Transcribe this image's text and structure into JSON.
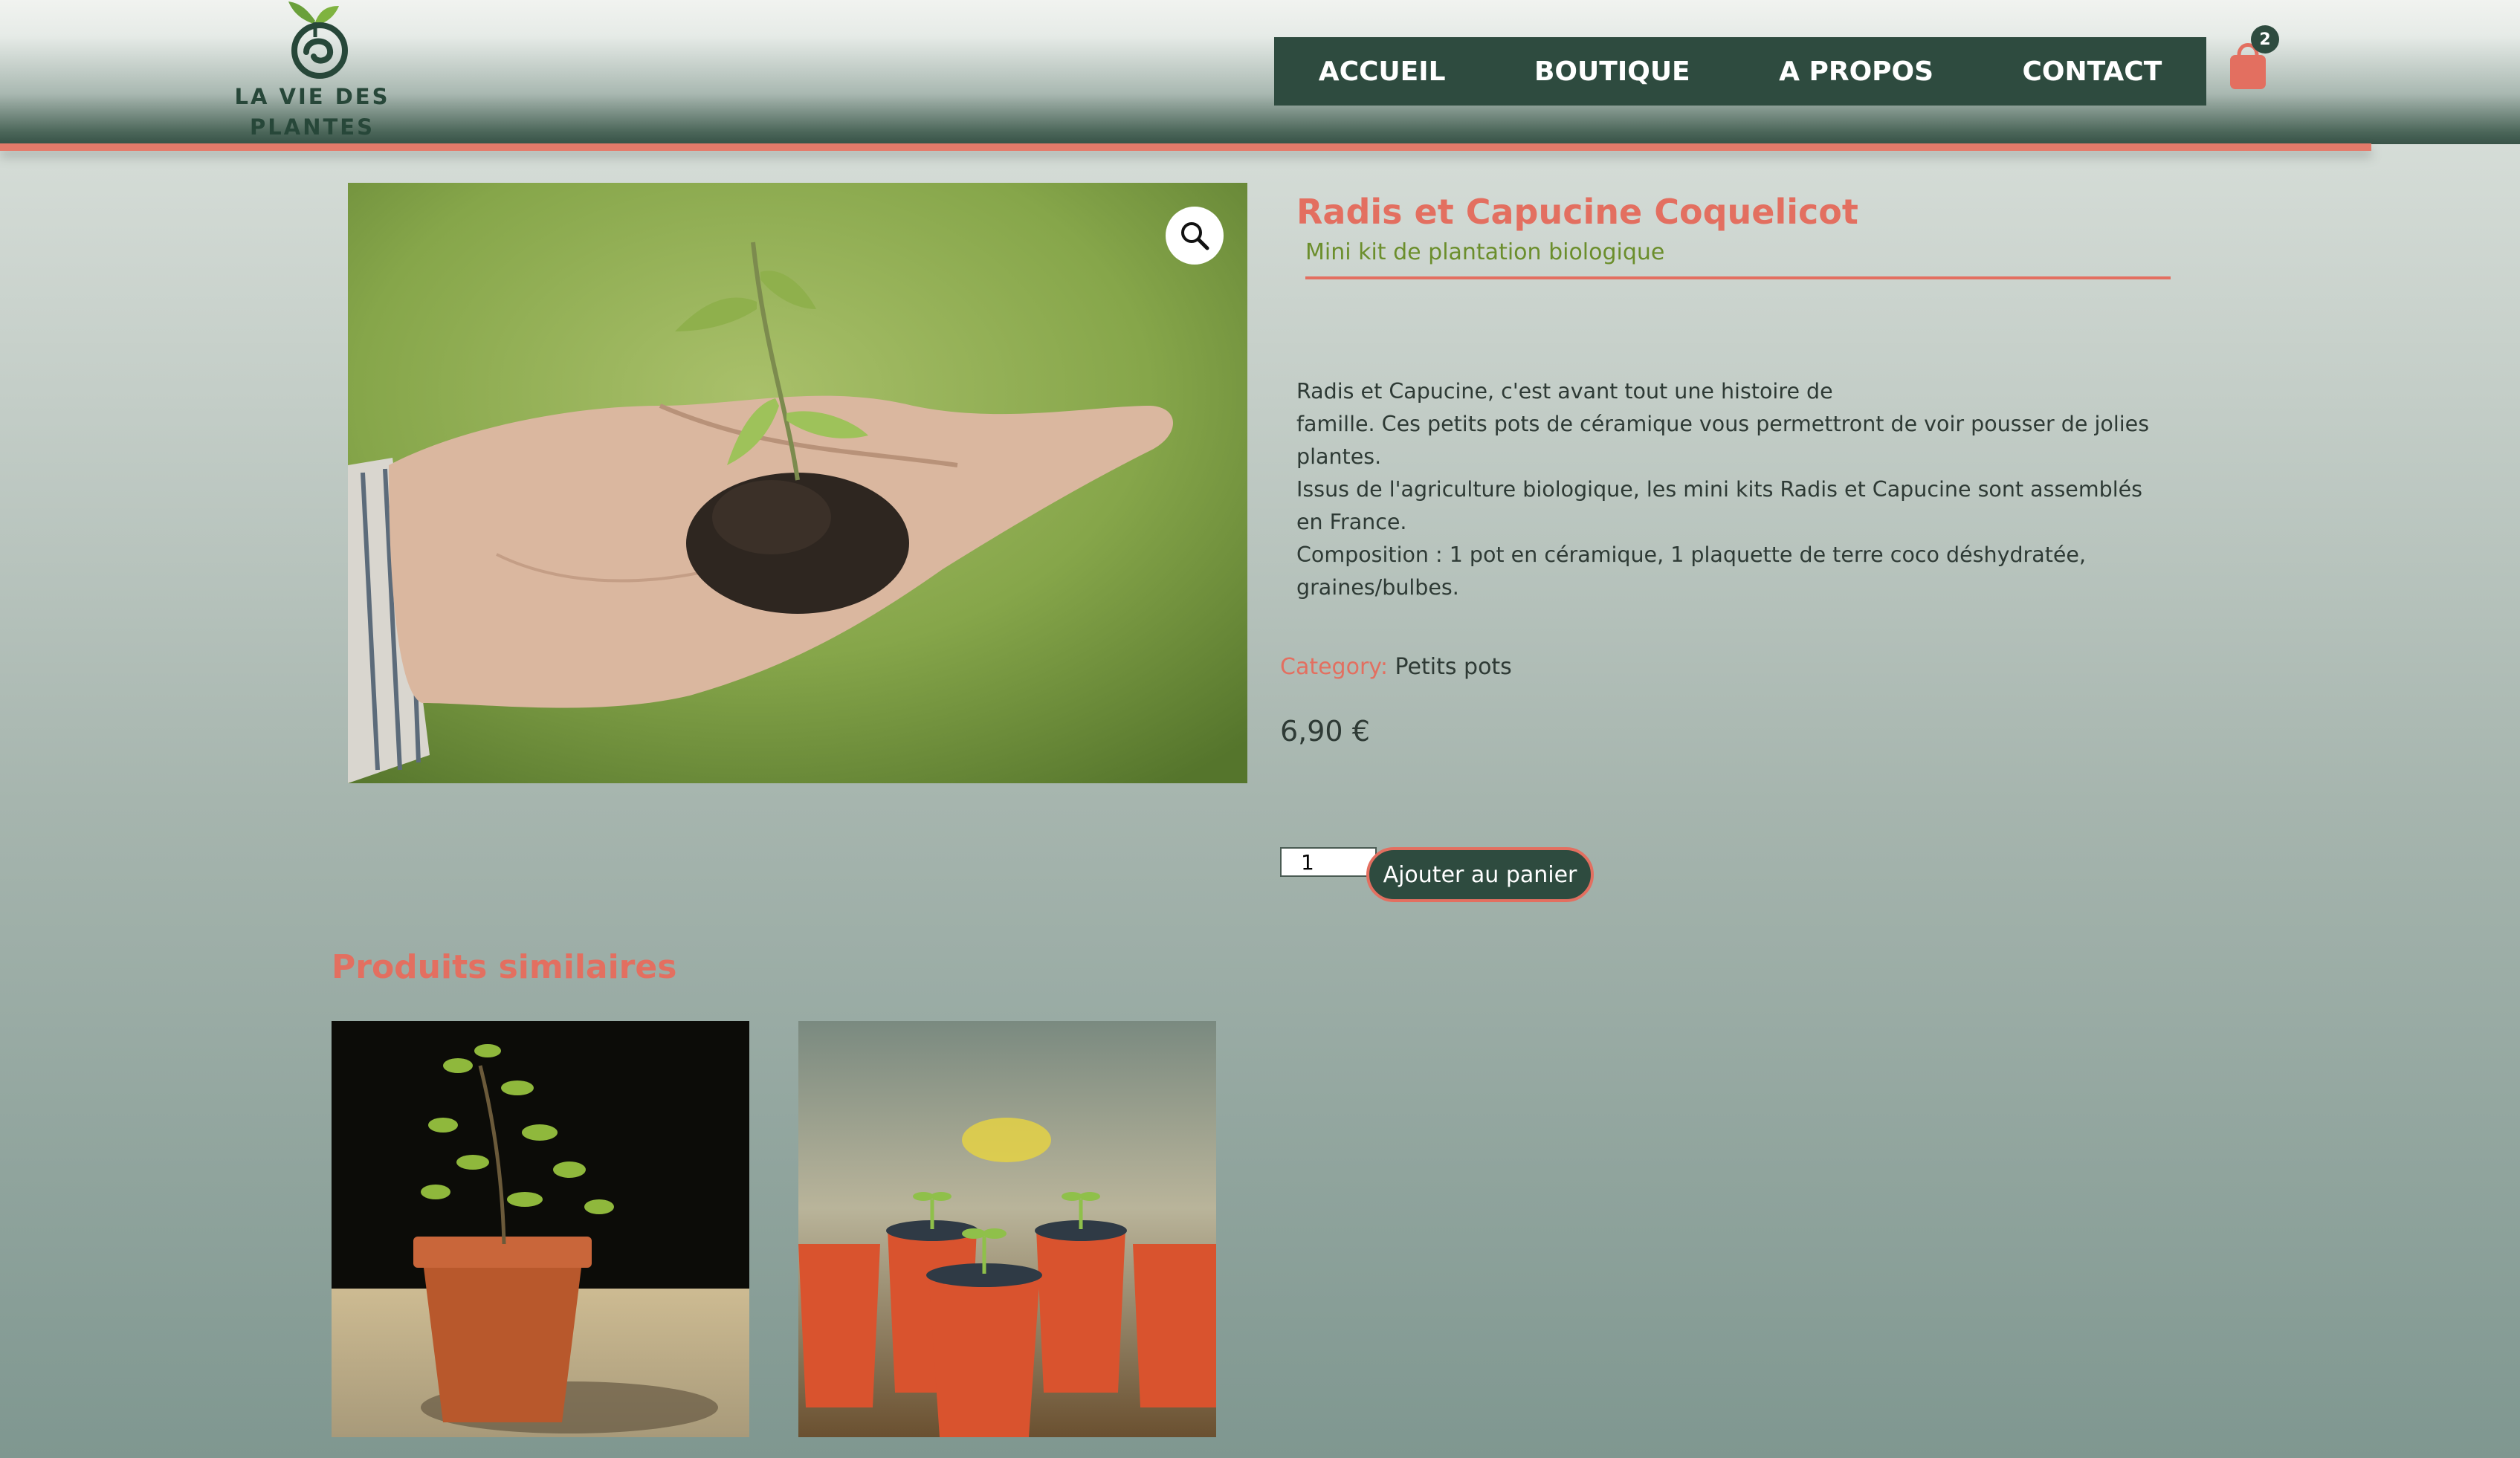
{
  "brand": {
    "line1": "LA VIE DES",
    "line2": "PLANTES"
  },
  "nav": {
    "items": [
      "ACCUEIL",
      "BOUTIQUE",
      "A PROPOS",
      "CONTACT"
    ]
  },
  "cart": {
    "count": "2",
    "icon": "shopping-bag-icon"
  },
  "product": {
    "title": "Radis et Capucine Coquelicot",
    "subtitle": "Mini kit de plantation biologique",
    "description": [
      "Radis et Capucine, c'est avant tout une histoire de",
      "famille. Ces petits pots de céramique vous permettront de voir pousser de jolies plantes.",
      "Issus de l'agriculture biologique, les mini kits Radis et Capucine sont assemblés en France.",
      "Composition : 1 pot en céramique, 1 plaquette de terre coco déshydratée, graines/bulbes."
    ],
    "category_label": "Category:",
    "category_value": "Petits pots",
    "price": "6,90 €",
    "quantity": "1",
    "add_to_cart_label": "Ajouter au panier"
  },
  "related": {
    "title": "Produits similaires"
  },
  "colors": {
    "accent": "#e36f60",
    "primary": "#2e4b3f",
    "subtitle": "#6b8e2c"
  }
}
